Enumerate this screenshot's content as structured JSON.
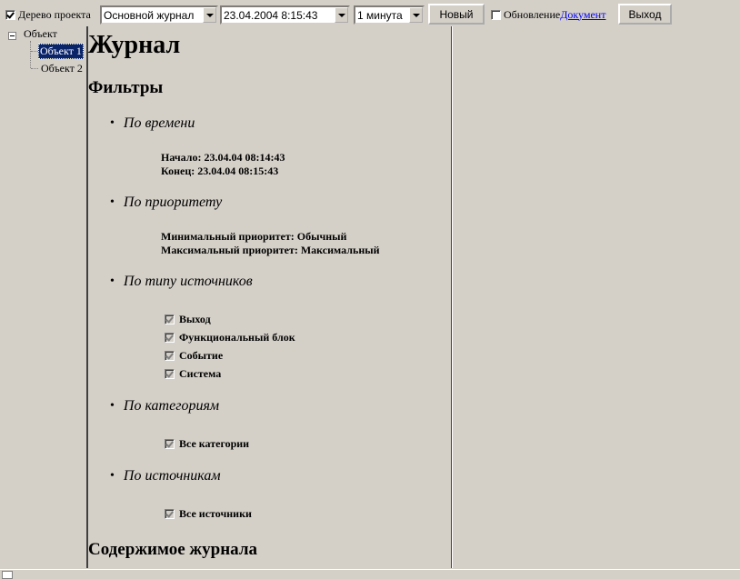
{
  "toolbar": {
    "tree_checkbox_label": "Дерево проекта",
    "tree_checked": true,
    "journal_combo_value": "Основной журнал",
    "datetime_combo_value": "23.04.2004 8:15:43",
    "interval_combo_value": "1 минута",
    "new_button_label": "Новый",
    "refresh_checkbox_label": "Обновление",
    "refresh_checked": false,
    "document_link_label": "Документ",
    "exit_button_label": "Выход"
  },
  "tree": {
    "root_label": "Объект",
    "children": [
      {
        "label": "Объект 1",
        "selected": true
      },
      {
        "label": "Объект 2",
        "selected": false
      }
    ]
  },
  "document": {
    "title": "Журнал",
    "filters_heading": "Фильтры",
    "sections": [
      {
        "title": "По времени",
        "lines": [
          "Начало: 23.04.04 08:14:43",
          "Конец: 23.04.04 08:15:43"
        ]
      },
      {
        "title": "По приоритету",
        "lines": [
          "Минимальный приоритет: Обычный",
          "Максимальный приоритет: Максимальный"
        ]
      },
      {
        "title": "По типу источников",
        "checks": [
          "Выход",
          "Функциональный блок",
          "Событие",
          "Система"
        ]
      },
      {
        "title": "По категориям",
        "checks": [
          "Все категории"
        ]
      },
      {
        "title": "По источникам",
        "checks": [
          "Все источники"
        ]
      }
    ],
    "content_heading": "Содержимое журнала"
  }
}
